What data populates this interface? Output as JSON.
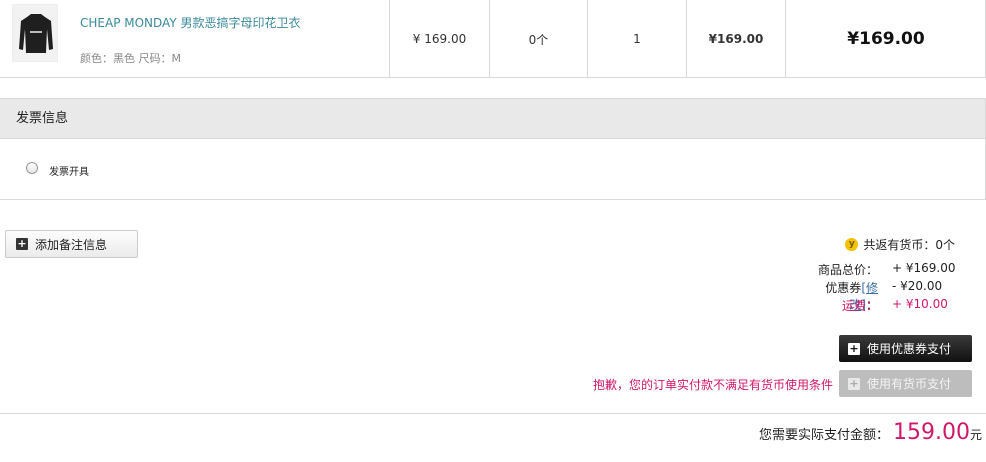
{
  "product": {
    "name": "CHEAP MONDAY 男款恶搞字母印花卫衣",
    "attributes": "颜色：黑色 尺码：M",
    "unit_price": "¥ 169.00",
    "coins": "0个",
    "quantity": "1",
    "subtotal": "¥169.00",
    "total": "¥169.00"
  },
  "invoice": {
    "title": "发票信息",
    "option_label": "发票开具"
  },
  "note_button": {
    "label": "添加备注信息"
  },
  "summary": {
    "coins_return": "共返有货币：0个",
    "goods_label": "商品总价：",
    "goods_value": "+ ¥169.00",
    "coupon_label": "优惠券",
    "coupon_modify": "[修改]",
    "coupon_colon": "：",
    "coupon_value": "- ¥20.00",
    "shipping_label": "运费：",
    "shipping_value": "+ ¥10.00"
  },
  "actions": {
    "coupon_pay_label": "使用优惠券支付",
    "coin_pay_label": "使用有货币支付",
    "coin_warning": "抱歉，您的订单实付款不满足有货币使用条件"
  },
  "total": {
    "label": "您需要实际支付金额：",
    "amount": "159.00",
    "unit": "元"
  },
  "colors": {
    "accent": "#d0186b",
    "link": "#3a8a9a"
  }
}
